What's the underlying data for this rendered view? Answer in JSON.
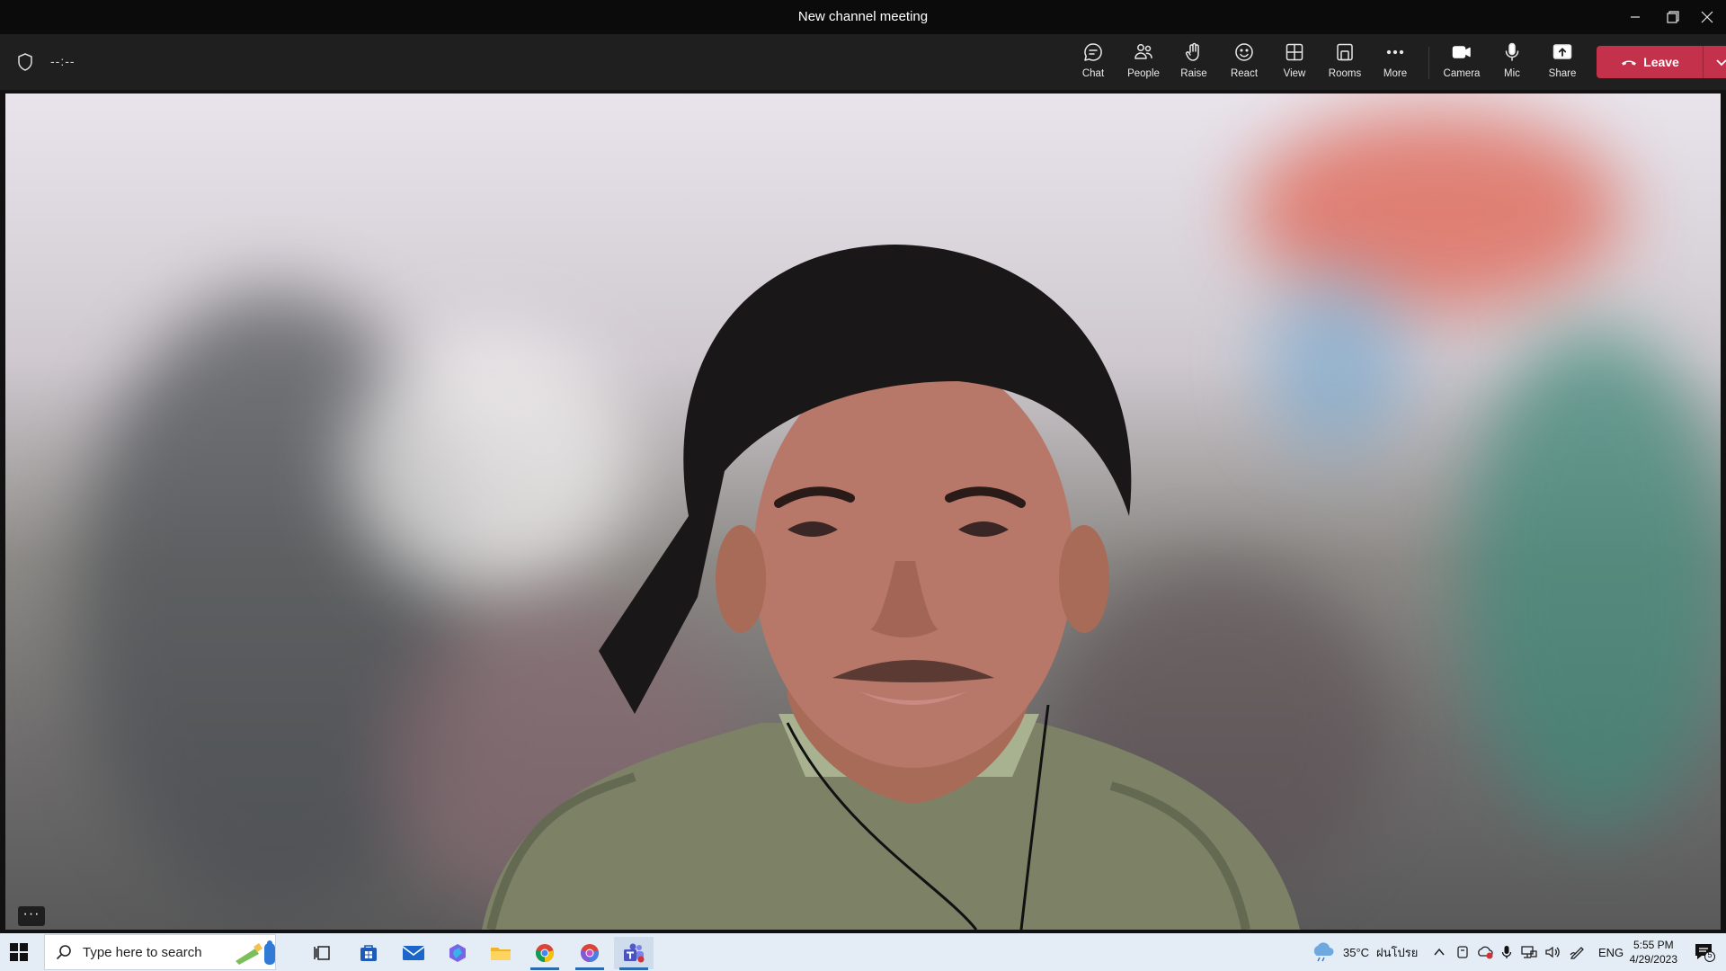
{
  "window": {
    "title": "New channel meeting"
  },
  "toolbar": {
    "timer": "--:--",
    "buttons": {
      "chat": "Chat",
      "people": "People",
      "raise": "Raise",
      "react": "React",
      "view": "View",
      "rooms": "Rooms",
      "more": "More",
      "camera": "Camera",
      "mic": "Mic",
      "share": "Share"
    },
    "leave_label": "Leave",
    "leave_color": "#c4314b"
  },
  "video": {
    "more_label": "···"
  },
  "taskbar": {
    "search_placeholder": "Type here to search",
    "weather_temp": "35°C",
    "weather_desc": "ฝนโปรย",
    "language": "ENG",
    "time": "5:55 PM",
    "date": "4/29/2023",
    "notification_count": "5",
    "pinned_apps": [
      "task-view",
      "microsoft-store",
      "mail",
      "copilot",
      "file-explorer",
      "chrome",
      "chrome-profile",
      "teams"
    ]
  }
}
